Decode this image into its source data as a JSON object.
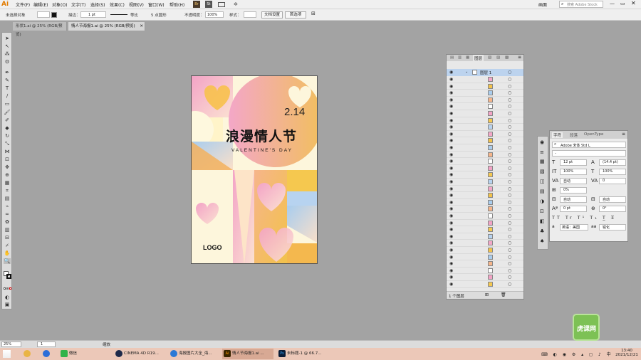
{
  "menubar": {
    "logo": "Ai",
    "items": [
      "文件(F)",
      "编辑(E)",
      "对象(O)",
      "文字(T)",
      "选择(S)",
      "效果(C)",
      "视图(V)",
      "窗口(W)",
      "帮助(H)"
    ],
    "workspace": "画面",
    "search_placeholder": "搜索 Adobe Stock"
  },
  "controlbar": {
    "selection": "未选择对象",
    "stroke_label": "描边：",
    "stroke_value": "1 pt",
    "stroke_style": "等比",
    "brush": "5 点圆形",
    "opacity_label": "不透明度：",
    "opacity_value": "100%",
    "style_label": "样式：",
    "doc_setup": "文档设置",
    "preferences": "首选项"
  },
  "tabs": [
    {
      "label": "形状1.ai @ 25% (RGB/预览)"
    },
    {
      "label": "情人节海报1.ai @ 25% (RGB/预览)"
    }
  ],
  "poster": {
    "date": "2.14",
    "title": "浪漫情人节",
    "subtitle": "VALENTINE'S DAY",
    "logo": "LOGO"
  },
  "layers": {
    "tabs": [
      "图层"
    ],
    "top_layer": "图层 1",
    "footer": "1 个图层"
  },
  "character": {
    "tabs": [
      "字符",
      "段落",
      "OpenType"
    ],
    "font": "Adobe 宋体 Std L",
    "font_style": "-",
    "size": "12 pt",
    "leading": "(14.4 pt)",
    "h_scale": "100%",
    "v_scale": "100%",
    "kerning": "自动",
    "tracking": "0",
    "rotation_a": "0%",
    "auto1": "自动",
    "auto2": "自动",
    "baseline": "0 pt",
    "char_rot": "0°",
    "lang": "英语：美国",
    "aa": "锐化"
  },
  "status": {
    "zoom": "25%",
    "artboard": "1",
    "tool": "缩放"
  },
  "taskbar": {
    "apps": [
      "微信",
      "CINEMA 4D R19...",
      "海报图片大全_海...",
      "情人节海报1.ai ...",
      "未标题-1 @ 66.7..."
    ],
    "time": "13:40",
    "date": "2021/12/21"
  },
  "watermark": "虎课网"
}
